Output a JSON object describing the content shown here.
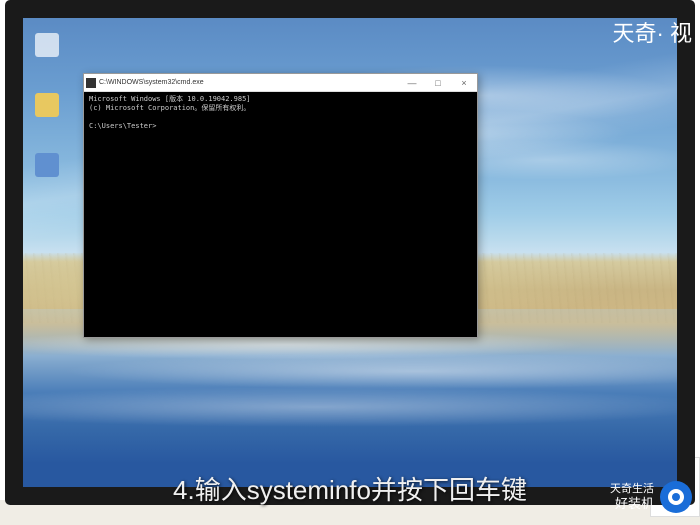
{
  "watermarks": {
    "top_right": "天奇· 视",
    "bottom_right_line1": "天奇生活",
    "bottom_right_line2": "好装机"
  },
  "subtitle": "4.输入systeminfo并按下回车键",
  "cmd": {
    "title": "C:\\WINDOWS\\system32\\cmd.exe",
    "line1": "Microsoft Windows [版本 10.0.19042.985]",
    "line2": "(c) Microsoft Corporation。保留所有权利。",
    "prompt": "C:\\Users\\Tester>"
  },
  "controls": {
    "minimize": "—",
    "maximize": "□",
    "close": "×"
  }
}
